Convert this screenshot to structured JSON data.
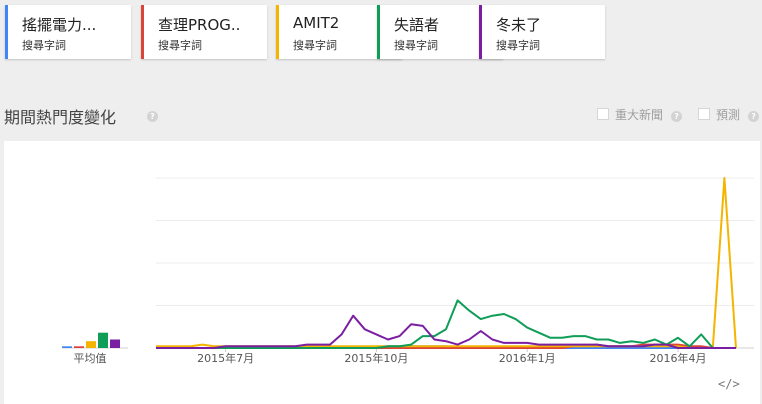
{
  "terms": [
    {
      "name": "搖擺電力...",
      "sub": "搜尋字詞",
      "color": "#4285f4"
    },
    {
      "name": "查理PROG..",
      "sub": "搜尋字詞",
      "color": "#db4437"
    },
    {
      "name": "AMIT2",
      "sub": "搜尋字詞",
      "color": "#f4b400"
    },
    {
      "name": "失語者",
      "sub": "搜尋字詞",
      "color": "#0f9d58"
    },
    {
      "name": "冬未了",
      "sub": "搜尋字詞",
      "color": "#7b1fa2"
    }
  ],
  "section": {
    "title": "期間熱門度變化",
    "news_label": "重大新聞",
    "forecast_label": "預測"
  },
  "chart_data": {
    "type": "line",
    "average_label": "平均值",
    "averages": [
      1,
      1,
      4,
      9,
      5
    ],
    "x_tick_labels": [
      "2015年7月",
      "2015年10月",
      "2016年1月",
      "2016年4月"
    ],
    "x_tick_positions": [
      6,
      19,
      32,
      45
    ],
    "ylim": [
      0,
      100
    ],
    "series": [
      {
        "name": "搖擺電力...",
        "color": "#4285f4",
        "values": [
          0,
          0,
          0,
          0,
          0,
          0,
          0,
          0,
          0,
          0,
          0,
          0,
          0,
          0,
          0,
          0,
          0,
          0,
          0,
          0,
          1,
          1,
          1,
          1,
          1,
          1,
          0,
          0,
          0,
          0,
          0,
          0,
          0,
          0,
          0,
          0,
          0,
          0,
          0,
          0,
          0,
          0,
          0,
          0,
          0,
          0,
          0,
          0,
          0,
          0,
          0
        ]
      },
      {
        "name": "查理PROG..",
        "color": "#db4437",
        "values": [
          0,
          0,
          0,
          0,
          0,
          0,
          0,
          0,
          0,
          0,
          0,
          0,
          0,
          0,
          0,
          0,
          0,
          0,
          0,
          0,
          0,
          0,
          0,
          0,
          0,
          0,
          0,
          0,
          0,
          0,
          0,
          0,
          0,
          0,
          0,
          0,
          1,
          1,
          2,
          1,
          1,
          1,
          2,
          2,
          2,
          2,
          1,
          1,
          0,
          0,
          0
        ]
      },
      {
        "name": "AMIT2",
        "color": "#f4b400",
        "values": [
          1,
          1,
          1,
          1,
          2,
          1,
          1,
          1,
          1,
          1,
          1,
          1,
          1,
          1,
          1,
          1,
          1,
          1,
          1,
          1,
          1,
          1,
          1,
          1,
          1,
          1,
          1,
          1,
          1,
          1,
          1,
          1,
          1,
          1,
          1,
          1,
          1,
          1,
          1,
          1,
          1,
          1,
          1,
          1,
          1,
          1,
          0,
          0,
          0,
          100,
          0
        ]
      },
      {
        "name": "失語者",
        "color": "#0f9d58",
        "values": [
          0,
          0,
          0,
          0,
          0,
          0,
          0,
          0,
          0,
          0,
          0,
          0,
          0,
          0,
          0,
          0,
          0,
          0,
          0,
          0,
          1,
          1,
          2,
          7,
          7,
          11,
          28,
          22,
          17,
          19,
          20,
          17,
          12,
          9,
          6,
          6,
          7,
          7,
          5,
          5,
          3,
          4,
          3,
          5,
          2,
          6,
          1,
          8,
          0,
          0,
          0
        ]
      },
      {
        "name": "冬未了",
        "color": "#7b1fa2",
        "values": [
          0,
          0,
          0,
          0,
          0,
          0,
          1,
          1,
          1,
          1,
          1,
          1,
          1,
          2,
          2,
          2,
          8,
          19,
          11,
          8,
          5,
          7,
          14,
          13,
          5,
          4,
          2,
          5,
          10,
          5,
          3,
          3,
          3,
          2,
          2,
          2,
          2,
          2,
          2,
          1,
          1,
          1,
          1,
          2,
          2,
          0,
          0,
          0,
          0,
          0,
          0
        ]
      }
    ]
  }
}
